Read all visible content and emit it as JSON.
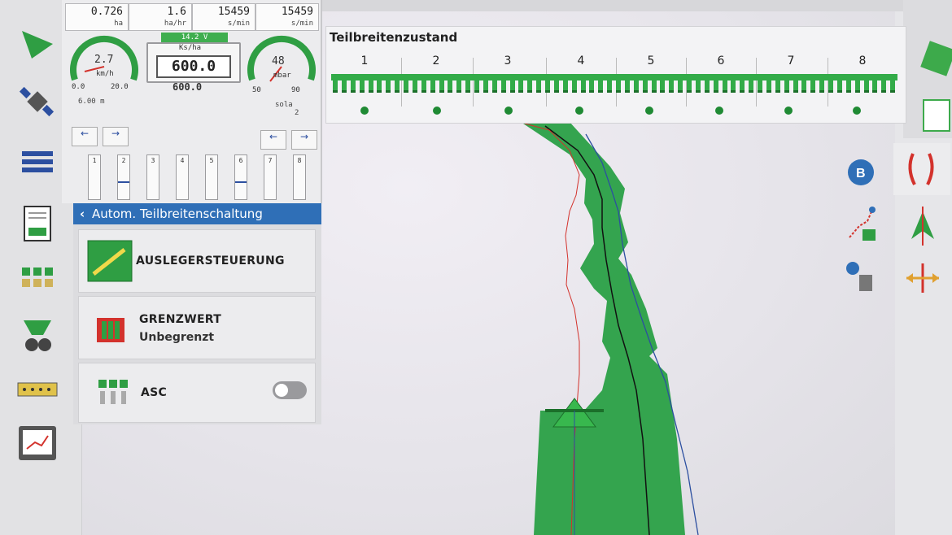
{
  "counters": [
    {
      "value": "0.726",
      "unit": "ha"
    },
    {
      "value": "1.6",
      "unit": "ha/hr"
    },
    {
      "value": "15459",
      "unit": "s/min"
    },
    {
      "value": "15459",
      "unit": "s/min"
    }
  ],
  "voltage": "14.2 V",
  "speed_gauge": {
    "value": "2.7",
    "unit": "km/h",
    "scale_min": "0.0",
    "scale_max": "20.0"
  },
  "pressure_gauge": {
    "value": "48",
    "unit": "mbar",
    "scale_min": "50",
    "scale_max": "90"
  },
  "rate": {
    "label": "Ks/ha",
    "value": "600.0",
    "target": "600.0"
  },
  "width_readout": "6.00 m",
  "sola_label": "sola",
  "sola_value": "2",
  "section_columns": [
    "1",
    "2",
    "3",
    "4",
    "5",
    "6",
    "7",
    "8"
  ],
  "menu": {
    "header": "Autom. Teilbreitenschaltung",
    "items": [
      {
        "label": "AUSLEGERSTEUERUNG"
      },
      {
        "label": "GRENZWERT",
        "sub": "Unbegrenzt"
      },
      {
        "label": "ASC",
        "toggle": "off"
      }
    ]
  },
  "section_panel": {
    "title": "Teilbreitenzustand",
    "sections": [
      "1",
      "2",
      "3",
      "4",
      "5",
      "6",
      "7",
      "8"
    ]
  },
  "colors": {
    "accent_green": "#2a9d3c",
    "header_blue": "#2f6fb7",
    "coverage_green": "#2aa046"
  },
  "icons": [
    "play-icon",
    "satellite-icon",
    "layers-icon",
    "report-icon",
    "sections-icon",
    "planter-icon",
    "row-units-icon",
    "monitor-icon",
    "b-point-icon",
    "path-icon",
    "delete-icon",
    "guidance-icon",
    "steer-icon",
    "shift-icon"
  ]
}
